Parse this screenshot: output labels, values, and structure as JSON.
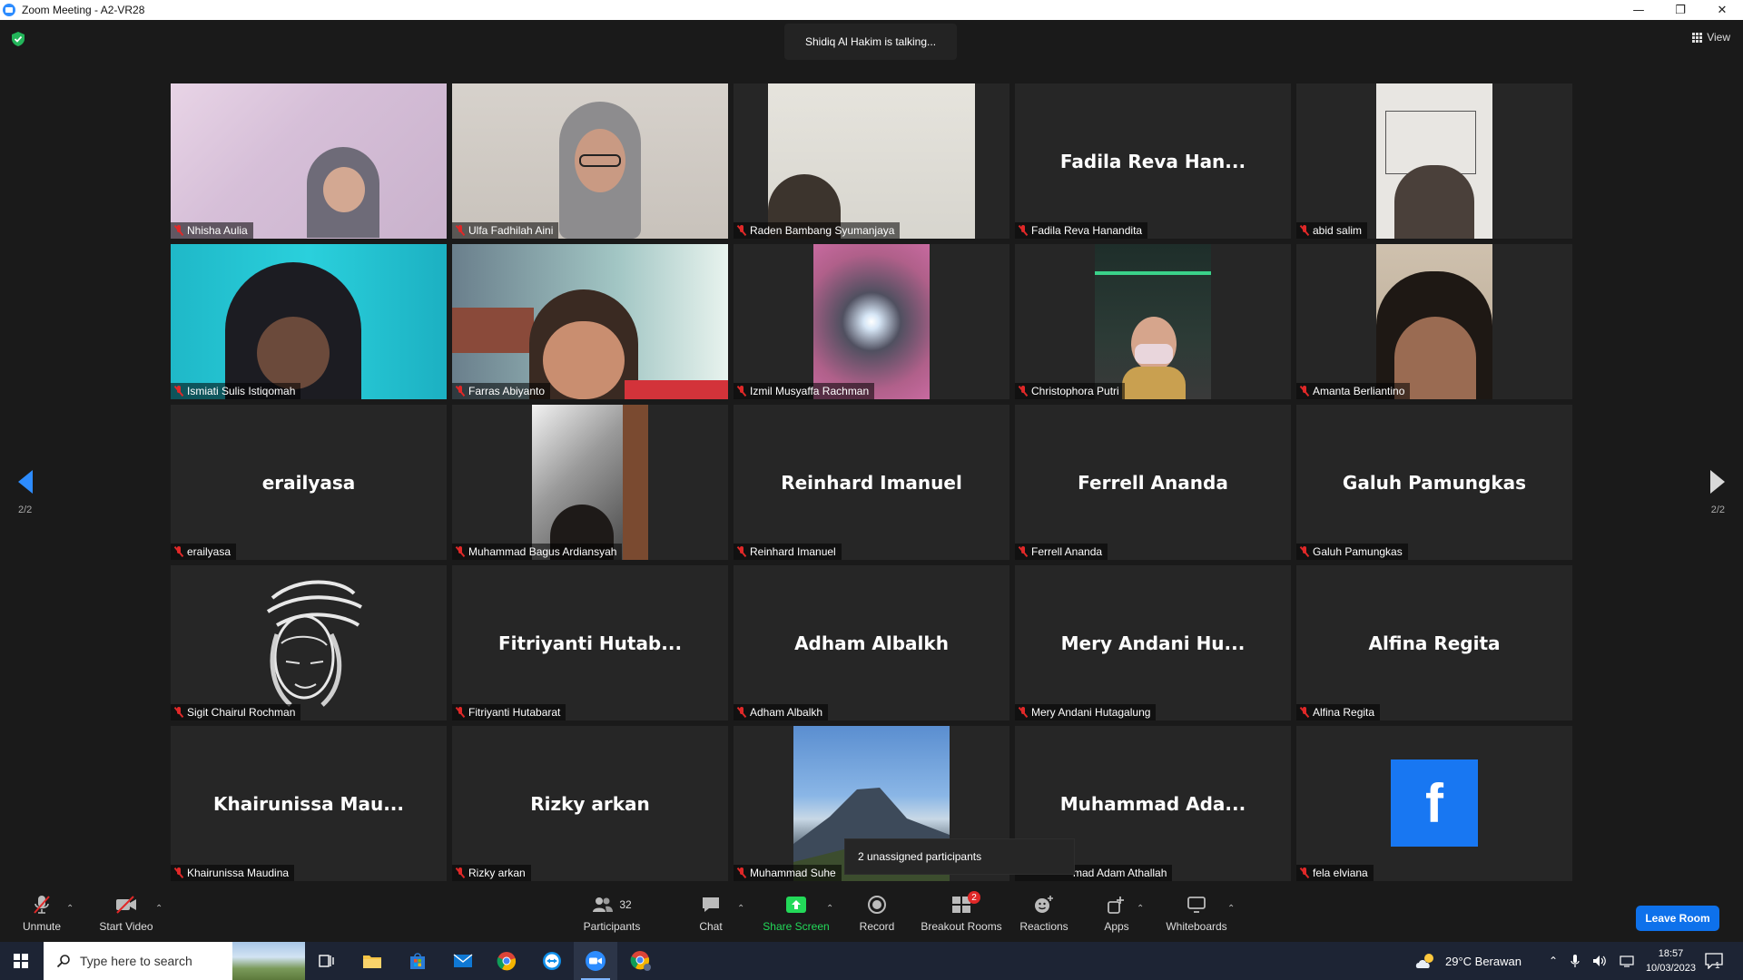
{
  "window": {
    "title": "Zoom Meeting - A2-VR28"
  },
  "meeting": {
    "talking": "Shidiq Al Hakim is talking...",
    "view_label": "View",
    "page_left": "2/2",
    "page_right": "2/2"
  },
  "tiles": [
    {
      "name": "Nhisha Aulia",
      "bigname": ""
    },
    {
      "name": "Ulfa Fadhilah Aini",
      "bigname": ""
    },
    {
      "name": "Raden Bambang Syumanjaya",
      "bigname": ""
    },
    {
      "name": "Fadila Reva Hanandita",
      "bigname": "Fadila Reva Han..."
    },
    {
      "name": "abid salim",
      "bigname": ""
    },
    {
      "name": "Ismiati Sulis Istiqomah",
      "bigname": ""
    },
    {
      "name": "Farras Abiyanto",
      "bigname": ""
    },
    {
      "name": "Izmil Musyaffa Rachman",
      "bigname": ""
    },
    {
      "name": "Christophora Putri",
      "bigname": ""
    },
    {
      "name": "Amanta Berliantino",
      "bigname": ""
    },
    {
      "name": "erailyasa",
      "bigname": "erailyasa"
    },
    {
      "name": "Muhammad Bagus Ardiansyah",
      "bigname": ""
    },
    {
      "name": "Reinhard Imanuel",
      "bigname": "Reinhard Imanuel"
    },
    {
      "name": "Ferrell Ananda",
      "bigname": "Ferrell Ananda"
    },
    {
      "name": "Galuh Pamungkas",
      "bigname": "Galuh Pamungkas"
    },
    {
      "name": "Sigit Chairul Rochman",
      "bigname": ""
    },
    {
      "name": "Fitriyanti Hutabarat",
      "bigname": "Fitriyanti Hutab..."
    },
    {
      "name": "Adham Albalkh",
      "bigname": "Adham Albalkh"
    },
    {
      "name": "Mery Andani Hutagalung",
      "bigname": "Mery Andani Hu..."
    },
    {
      "name": "Alfina Regita",
      "bigname": "Alfina Regita"
    },
    {
      "name": "Khairunissa Maudina",
      "bigname": "Khairunissa Mau..."
    },
    {
      "name": "Rizky arkan",
      "bigname": "Rizky arkan"
    },
    {
      "name": "Muhammad Suhe",
      "bigname": ""
    },
    {
      "name": "mad Adam Athallah",
      "bigname": "Muhammad Ada..."
    },
    {
      "name": "fela elviana",
      "bigname": ""
    }
  ],
  "tooltip": "2 unassigned participants",
  "toolbar": {
    "unmute": "Unmute",
    "start_video": "Start Video",
    "participants": "Participants",
    "participants_count": "32",
    "chat": "Chat",
    "share_screen": "Share Screen",
    "record": "Record",
    "breakout_rooms": "Breakout Rooms",
    "breakout_badge": "2",
    "reactions": "Reactions",
    "apps": "Apps",
    "whiteboards": "Whiteboards",
    "leave": "Leave Room"
  },
  "taskbar": {
    "search_placeholder": "Type here to search",
    "weather": "29°C  Berawan",
    "time": "18:57",
    "date": "10/03/2023",
    "notif_count": "1"
  },
  "colors": {
    "accent": "#0e71eb",
    "share_green": "#23d959",
    "muted_red": "#e02828",
    "facebook_blue": "#1877f2"
  }
}
